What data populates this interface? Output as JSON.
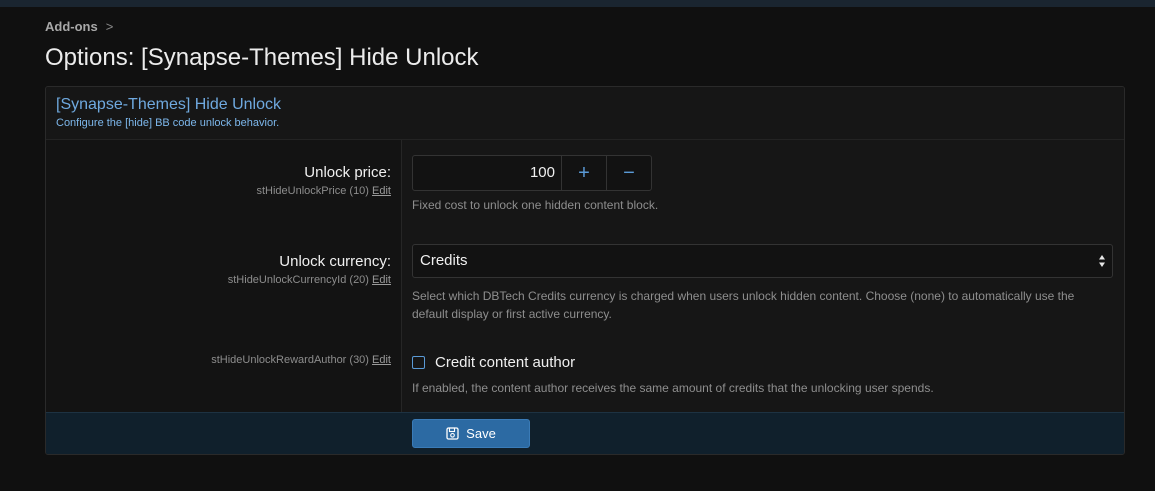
{
  "breadcrumb": {
    "item": "Add-ons",
    "separator": ">"
  },
  "page": {
    "title": "Options: [Synapse-Themes] Hide Unlock"
  },
  "block": {
    "title": "[Synapse-Themes] Hide Unlock",
    "description": "Configure the [hide] BB code unlock behavior."
  },
  "options": {
    "price": {
      "label": "Unlock price:",
      "id_text": "stHideUnlockPrice (10)",
      "edit": "Edit",
      "value": "100",
      "plus": "+",
      "minus": "−",
      "hint": "Fixed cost to unlock one hidden content block."
    },
    "currency": {
      "label": "Unlock currency:",
      "id_text": "stHideUnlockCurrencyId (20)",
      "edit": "Edit",
      "value": "Credits",
      "hint": "Select which DBTech Credits currency is charged when users unlock hidden content. Choose (none) to automatically use the default display or first active currency."
    },
    "reward": {
      "id_text": "stHideUnlockRewardAuthor (30)",
      "edit": "Edit",
      "checkbox_label": "Credit content author",
      "checked": false,
      "hint": "If enabled, the content author receives the same amount of credits that the unlocking user spends."
    }
  },
  "footer": {
    "save_label": "Save"
  },
  "colors": {
    "accent": "#2c6aa3",
    "link": "#6fa9df",
    "background": "#101010"
  }
}
